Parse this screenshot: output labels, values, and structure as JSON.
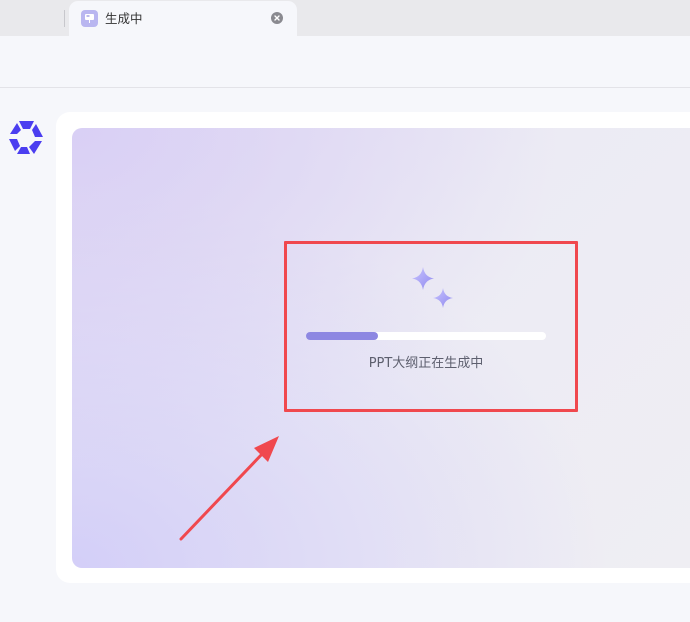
{
  "browser": {
    "tab": {
      "title": "生成中",
      "favicon": "presentation-icon"
    },
    "tab_close_icon": "close-icon"
  },
  "sidebar": {
    "logo": "app-logo-icon"
  },
  "main": {
    "status_text": "PPT大纲正在生成中",
    "progress": {
      "fraction": 0.3
    },
    "decoration": "sparkle-icon"
  },
  "annotation": {
    "box_color": "#f0484e",
    "arrow_color": "#f0484e"
  },
  "colors": {
    "accent": "#8d87e2",
    "logo": "#4b3ef0"
  }
}
